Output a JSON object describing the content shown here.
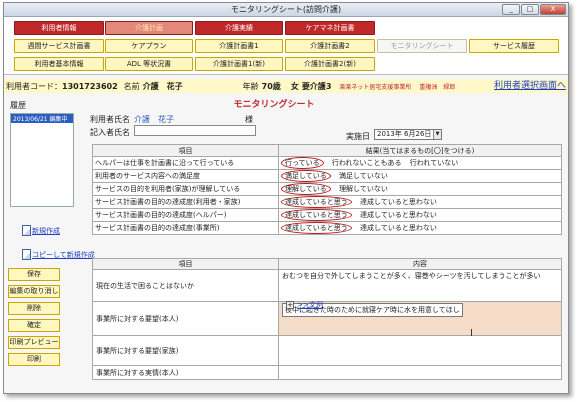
{
  "window": {
    "title": "モニタリングシート(訪問介護)",
    "controls": [
      "_",
      "□",
      "X"
    ]
  },
  "nav": {
    "row1": [
      "利用者情報",
      "介護計画",
      "介護実績",
      "ケアマネ計画書"
    ],
    "row2": [
      "週間サービス計画書",
      "ケアプラン",
      "介護計画書1",
      "介護計画書2",
      "モニタリングシート",
      "サービス履歴"
    ],
    "row3": [
      "利用者基本情報",
      "ADL 等状況書",
      "介護計画書1(新)",
      "介護計画書2(新)"
    ],
    "active_tab": "介護計画",
    "active_sub": "モニタリングシート"
  },
  "info": {
    "user_code_label": "利用者コード：",
    "user_code": "1301723602",
    "name_label": "名前",
    "name": "介護　花子",
    "age_label": "年齢",
    "age": "70歳",
    "sex": "女",
    "care_level_label": "要介護",
    "care_level": "3",
    "office": "楽楽ネット居宅支援事業所",
    "staff": "重複洲　緑郎",
    "select_screen": "利用者選択画面へ"
  },
  "sheet": {
    "title": "モニタリングシート"
  },
  "history": {
    "label": "履歴",
    "items": [
      "2013/06/21 編集中"
    ]
  },
  "left_links": {
    "new": "新規作成",
    "copy_new": "コピーして新規作成"
  },
  "side_buttons": [
    "保存",
    "編集の取り消し",
    "削除",
    "確定",
    "印刷プレビュー",
    "印刷"
  ],
  "form": {
    "user_name_label": "利用者氏名",
    "user_name": "介護　花子",
    "honorific": "様",
    "recorder_label": "記入者氏名",
    "recorder_value": "",
    "date_label": "実施日",
    "date_value": "2013年 6月26日"
  },
  "evaluation": {
    "col_item": "項目",
    "col_result": "結果(当てはまるもの[〇]をつける)",
    "rows": [
      {
        "item": "ヘルパーは仕事を計画書に沿って行っている",
        "options": [
          "行っている",
          "行われないこともある",
          "行われていない"
        ],
        "selected": 0
      },
      {
        "item": "利用者のサービス内容への満足度",
        "options": [
          "満足している",
          "満足していない"
        ],
        "selected": 0
      },
      {
        "item": "サービスの目的を利用者(家族)が理解している",
        "options": [
          "理解している",
          "理解していない"
        ],
        "selected": 0
      },
      {
        "item": "サービス計画書の目的の達成度(利用者・家族)",
        "options": [
          "達成していると思う",
          "達成していると思わない"
        ],
        "selected": 0
      },
      {
        "item": "サービス計画書の目的の達成度(ヘルパー)",
        "options": [
          "達成していると思う",
          "達成していると思わない"
        ],
        "selected": 0
      },
      {
        "item": "サービス計画書の目的の達成度(事業所)",
        "options": [
          "達成していると思う",
          "達成していると思わない"
        ],
        "selected": 0
      }
    ]
  },
  "requests": {
    "col_item": "項目",
    "col_content": "内容",
    "rows": [
      {
        "item": "現在の生活で困ることはないか",
        "content": "おむつを自分で外してしまうことが多く、寝巻やシーツを汚してしまうことが多い"
      },
      {
        "item": "事業所に対する要望(本人)",
        "content": "夜中に起きた時のために就寝ケア時に水を用意してほし"
      },
      {
        "item": "事業所に対する要望(家族)",
        "content": ""
      },
      {
        "item": "事業所に対する実情(本人)",
        "content": ""
      }
    ],
    "mini_toolbar": {
      "plus": "+",
      "link": ">>文例"
    }
  }
}
